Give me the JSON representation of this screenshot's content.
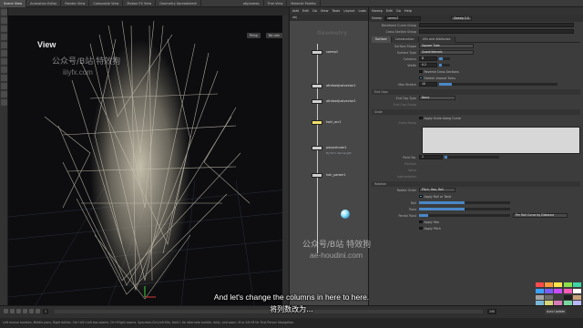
{
  "tabs": [
    "Scene View",
    "Animation Editor",
    "Render View",
    "Composite View",
    "Motion FX View",
    "Geometry Spreadsheet"
  ],
  "viewport": {
    "title": "View",
    "persp_label": "Persp",
    "cam_label": "No cam"
  },
  "watermark": {
    "cn": "公众号/B站 特效狗",
    "url": "iiiyfx.com"
  },
  "network": {
    "tabs": [
      "obj/sweep",
      "Tree View",
      "Material Palette"
    ],
    "menu": [
      "Add",
      "Edit",
      "Go",
      "View",
      "Tools",
      "Layout",
      "Labs",
      "Help"
    ],
    "path": "obj",
    "background_label": "Geometry",
    "nodes": [
      {
        "name": "sweep1"
      },
      {
        "name": "attribadjustvector1"
      },
      {
        "name": "attribadjustvector2"
      },
      {
        "name": "twirl_arc1"
      },
      {
        "name": "polyextrude1",
        "sub": "By Prim, Set Length"
      },
      {
        "name": "hair_param1"
      }
    ]
  },
  "params": {
    "node_type": "Sweep",
    "node_name": "sweep1",
    "version": "Sweep 2.0",
    "menu": [
      "Sweep",
      "Edit",
      "Go",
      "Help"
    ],
    "rows_top": [
      {
        "label": "Backbone Curve Group",
        "value": ""
      },
      {
        "label": "Cross Section Group",
        "value": ""
      }
    ],
    "tabs": [
      "Surface",
      "Construction",
      "UVs and Attributes"
    ],
    "surface": {
      "shape_label": "Surface Shape",
      "shape_value": "Square Tube",
      "type_label": "Surface Type",
      "type_value": "Quadrilaterals",
      "columns_label": "Columns",
      "columns_value": "8",
      "width_label": "Width",
      "width_value": "0.2",
      "reverse_label": "Reverse Cross Sections",
      "stretch_label": "Stretch Around Turns",
      "max_stretch_label": "Max Stretch",
      "max_stretch_value": "10"
    },
    "end_caps": {
      "section": "End Caps",
      "type_label": "End Cap Type",
      "type_value": "None",
      "group_label": "End Cap Group"
    },
    "scale": {
      "section": "Scale",
      "apply_label": "Apply Scale Along Curve",
      "ramp_label": "Scale Ramp",
      "point_no_label": "Point No.",
      "point_no_value": "1",
      "position_label": "Position",
      "value_label": "Value",
      "interp_label": "Interpolation"
    },
    "rotation": {
      "section": "Rotation",
      "order_label": "Rotate Order",
      "order_value": "Pitch, Yaw, Roll",
      "roll_label": "Apply Roll or Twist",
      "roll_field_label": "Roll",
      "twist_label": "Twist",
      "partial_label": "Partial Twist",
      "partial_value": "Per Roll Curve by Distance",
      "yaw_label": "Apply Yaw",
      "pitch_label": "Apply Pitch"
    }
  },
  "subtitle": {
    "en": "And let's change the columns in here to here.",
    "cn": "将列数改为..."
  },
  "watermark2": {
    "cn": "公众号/B站 特效狗",
    "url": "ae-houdini.com"
  },
  "status": "Left mouse tumbles, Middle pans, Right dollies. Ctrl+Alt+Left box zooms. Ctrl+Right zooms. Spacebar-Ctrl-Left tilts. Hold L for alternate tumble, dolly, and zoom. M or Alt+M for First Person Navigation.",
  "timeline": {
    "frame": "1",
    "end": "240",
    "auto_update": "Auto Update"
  },
  "colors": {
    "accent": "#4a88c7",
    "selected_node": "#f0e06a",
    "sphere": "#8fe2ff"
  },
  "palette": [
    "#ff4b4b",
    "#ff9a3c",
    "#ffe54a",
    "#8ee04a",
    "#3cd6a5",
    "#3ca0ff",
    "#7a5cff",
    "#c84cff",
    "#ff5cb8",
    "#ffffff",
    "#a3a3a3",
    "#6b6b6b",
    "#3c3c3c",
    "#1f1f1f",
    "#c9a27a",
    "#7ab8d6",
    "#d6d67a",
    "#d67ab8",
    "#7ad6a0",
    "#b8b8ff"
  ]
}
